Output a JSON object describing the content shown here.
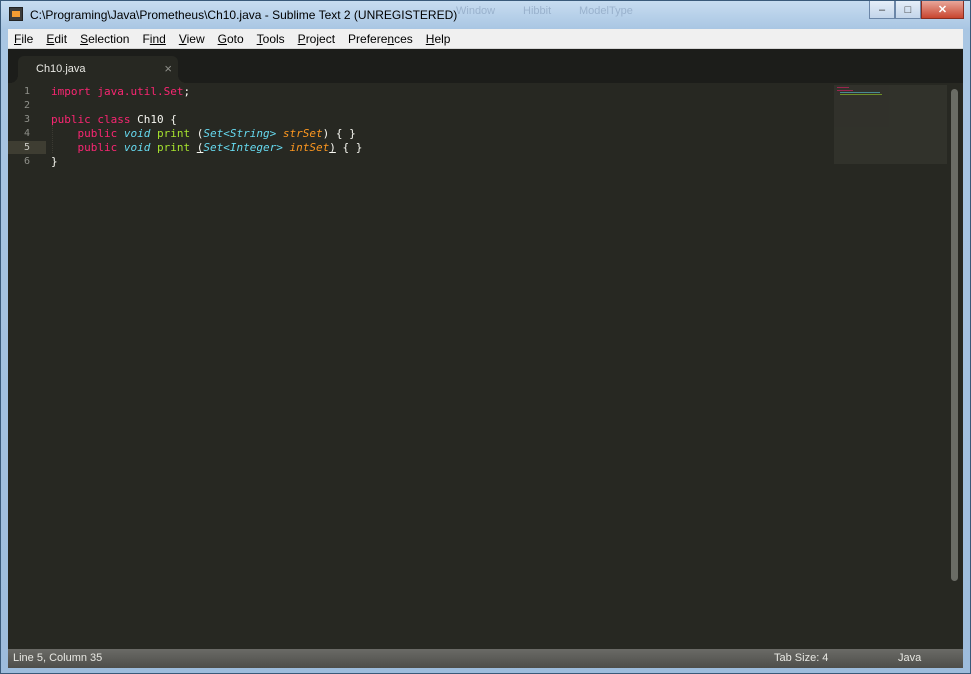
{
  "window": {
    "title": "C:\\Programing\\Java\\Prometheus\\Ch10.java - Sublime Text 2 (UNREGISTERED)",
    "controls": {
      "minimize": "–",
      "maximize": "□",
      "close": "✕"
    },
    "ghost_texts": [
      "Window",
      "Hibbit",
      "ModelType"
    ]
  },
  "menu": {
    "items": [
      {
        "mnemonic": "F",
        "rest": "ile"
      },
      {
        "mnemonic": "E",
        "rest": "dit"
      },
      {
        "mnemonic": "S",
        "rest": "election"
      },
      {
        "mnemonic": "F",
        "rest": "ind",
        "prefix": "",
        "pre": ""
      },
      {
        "mnemonic": "V",
        "rest": "iew"
      },
      {
        "mnemonic": "G",
        "rest": "oto"
      },
      {
        "mnemonic": "T",
        "rest": "ools"
      },
      {
        "mnemonic": "P",
        "rest": "roject"
      },
      {
        "mnemonic": "n",
        "pre": "Prefere",
        "rest": "ces"
      },
      {
        "mnemonic": "H",
        "rest": "elp"
      }
    ]
  },
  "tabs": [
    {
      "label": "Ch10.java",
      "close": "×"
    }
  ],
  "editor": {
    "line_numbers": [
      "1",
      "2",
      "3",
      "4",
      "5",
      "6"
    ],
    "current_line": 5,
    "lines": [
      {
        "import": "import",
        "pkg": "java.util.Set",
        "semi": ";"
      },
      {},
      {
        "public": "public",
        "class": "class",
        "name": "Ch10",
        "brace": "{"
      },
      {
        "public": "public",
        "void": "void",
        "fn": "print",
        "open": "(",
        "type": "Set<String>",
        "param": "strSet",
        "close": ")",
        "body": "{ }"
      },
      {
        "public": "public",
        "void": "void",
        "fn": "print",
        "open": "(",
        "type": "Set<Integer>",
        "param": "intSet",
        "close": ")",
        "body": "{ }"
      },
      {
        "brace": "}"
      }
    ]
  },
  "colors": {
    "background": "#272822",
    "keyword": "#f92672",
    "type": "#66d9ef",
    "function": "#a6e22e",
    "parameter": "#fd971f",
    "text": "#f8f8f2",
    "gutter": "#8f908a"
  },
  "statusbar": {
    "position": "Line 5, Column 35",
    "tab_size": "Tab Size: 4",
    "syntax": "Java"
  }
}
